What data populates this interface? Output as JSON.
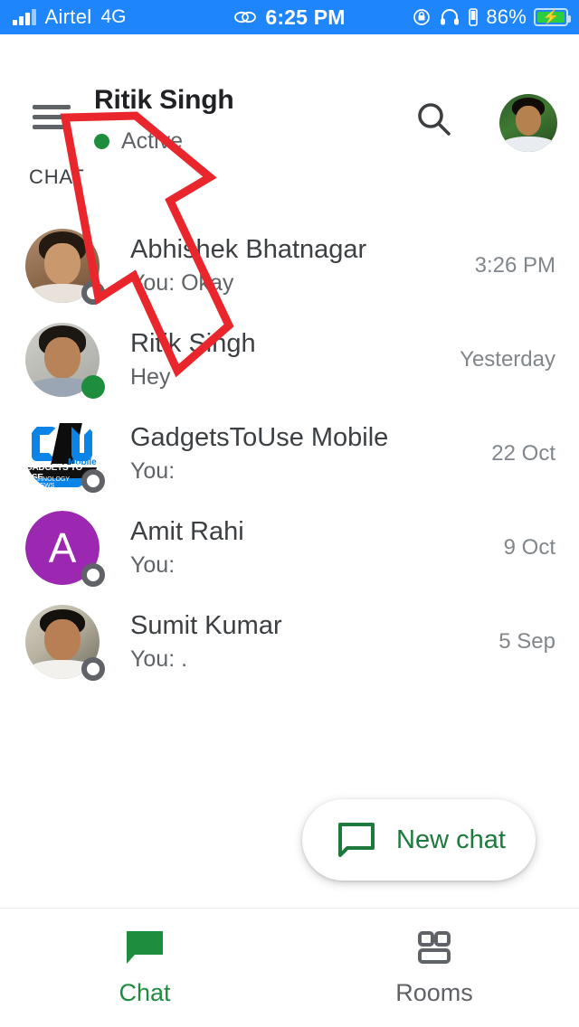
{
  "statusbar": {
    "carrier": "Airtel",
    "network": "4G",
    "link_icon": "link-icon",
    "time": "6:25 PM",
    "rotation_icon": "rotation-lock-icon",
    "headphones_icon": "headphones-icon",
    "vibrate_icon": "vibrate-icon",
    "battery_percent": "86%",
    "battery_icon": "battery-charging-icon",
    "background_color": "#1e86fa"
  },
  "header": {
    "menu_icon": "hamburger-menu-icon",
    "title": "Ritik Singh",
    "presence": "Active",
    "presence_color": "#1e8e3e",
    "search_icon": "search-icon",
    "avatar": "profile-avatar"
  },
  "section": {
    "label": "CHAT"
  },
  "chats": [
    {
      "name": "Abhishek Bhatnagar",
      "snippet": "You: Okay",
      "time": "3:26 PM",
      "status": "offline",
      "avatar_type": "photo"
    },
    {
      "name": "Ritik Singh",
      "snippet": "Hey",
      "time": "Yesterday",
      "status": "online",
      "avatar_type": "photo"
    },
    {
      "name": "GadgetsToUse Mobile",
      "snippet": "You:",
      "time": "22 Oct",
      "status": "offline",
      "avatar_type": "logo",
      "logo_text": {
        "mobile": "Mobile",
        "line1": "GADGETS TO USE",
        "line2": "TECHNOLOGY REVIEWS"
      }
    },
    {
      "name": "Amit Rahi",
      "snippet": "You:",
      "time": "9 Oct",
      "status": "offline",
      "avatar_type": "letter",
      "letter": "A",
      "letter_color": "#9c27b0"
    },
    {
      "name": "Sumit Kumar",
      "snippet": "You: .",
      "time": "5 Sep",
      "status": "offline",
      "avatar_type": "photo"
    }
  ],
  "fab": {
    "label": "New chat",
    "icon": "chat-bubble-outline-icon",
    "color": "#1e7a3c"
  },
  "bottomnav": {
    "items": [
      {
        "label": "Chat",
        "icon": "chat-bubble-filled-icon",
        "active": true
      },
      {
        "label": "Rooms",
        "icon": "rooms-grid-icon",
        "active": false
      }
    ],
    "active_color": "#1e8e3e",
    "inactive_color": "#5f6368"
  },
  "annotation": {
    "shape": "arrow-pointing-up-left",
    "color": "#e8262b"
  }
}
